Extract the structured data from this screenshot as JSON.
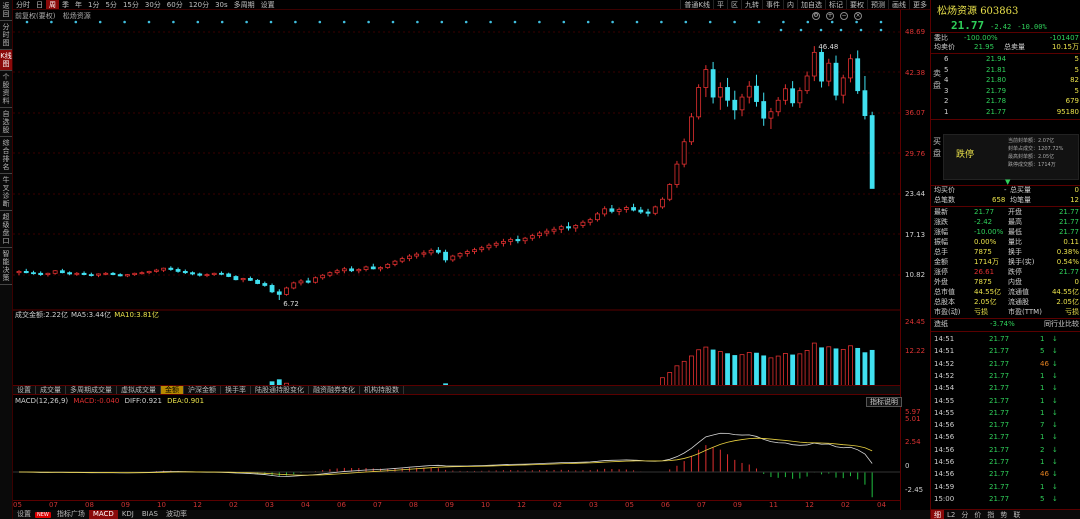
{
  "left_sidebar": [
    "返回",
    "分时图",
    "K线图",
    "个股资料",
    "自选股",
    "综合排名",
    "牛叉诊断",
    "超级盘口",
    "智能决策"
  ],
  "toolbar": {
    "left": [
      "分时",
      "日",
      "周",
      "季",
      "年",
      "1分",
      "5分",
      "15分",
      "30分",
      "60分",
      "120分",
      "30s",
      "多周期",
      "设置"
    ],
    "active_left": "周",
    "right": [
      "普通K线",
      "平",
      "区",
      "九转",
      "事件",
      "内",
      "加自选",
      "标记",
      "要权",
      "预测",
      "画线",
      "更多"
    ]
  },
  "stock_line": {
    "label": "前复权(要权)",
    "name": "松炀资源"
  },
  "price_axis": [
    "48.69",
    "42.38",
    "36.07",
    "29.76",
    "23.44",
    "17.13",
    "10.82"
  ],
  "price_marks": {
    "high": "46.48",
    "low": "6.72"
  },
  "volume": {
    "title": "成交金额:",
    "value": "2.22亿",
    "ma5_label": "MA5:",
    "ma5": "3.44亿",
    "ma10_label": "MA10:",
    "ma10": "3.81亿",
    "axis_top": "24.45",
    "axis_mid": "12.22"
  },
  "mid_tabs": [
    "设置",
    "成交量",
    "多周期成交量",
    "虚拟成交量",
    "金额",
    "沪深金额",
    "换手率",
    "陆股通持股变化",
    "融资融券变化",
    "机构持股数"
  ],
  "active_mid_tab": "金额",
  "macd": {
    "title": "MACD(12,26,9)",
    "macd_label": "MACD:",
    "macd": "-0.040",
    "diff_label": "DIFF:",
    "diff": "0.921",
    "dea_label": "DEA:",
    "dea": "0.901",
    "axis": [
      "5.97",
      "5.01",
      "2.54",
      "0",
      "-2.45"
    ],
    "indicator_button": "指标说明"
  },
  "dates": [
    "05",
    "07",
    "08",
    "09",
    "10",
    "12",
    "02",
    "03",
    "04",
    "06",
    "07",
    "08",
    "09",
    "10",
    "12",
    "02",
    "03",
    "05",
    "06",
    "07",
    "09",
    "11",
    "12",
    "02",
    "04"
  ],
  "bottom_tabs": [
    "设置",
    "指标广场",
    "MACD",
    "KDJ",
    "BIAS",
    "波动率"
  ],
  "new_badge": "NEW",
  "active_bottom_tab": "MACD",
  "right_panel": {
    "name": "松炀资源",
    "code": "603863",
    "price": "21.77",
    "change": "-2.42",
    "change_pct": "-10.00%",
    "weibi_label": "委比",
    "weibi": "-100.00%",
    "weicha": "-101407",
    "avg_sell_label": "均卖价",
    "avg_sell": "21.95",
    "total_sell_label": "总卖量",
    "total_sell": "10.15万",
    "sell_side_label": "卖盘",
    "asks": [
      [
        "6",
        "21.94",
        "5"
      ],
      [
        "5",
        "21.81",
        "5"
      ],
      [
        "4",
        "21.80",
        "82"
      ],
      [
        "3",
        "21.79",
        "5"
      ],
      [
        "2",
        "21.78",
        "679"
      ],
      [
        "1",
        "21.77",
        "95180"
      ]
    ],
    "buy_side_label": "买盘",
    "limit": {
      "text": "跌停",
      "lines": [
        "当前封单额：2.07亿",
        "封单占成交：1207.72%",
        "最高封单额：2.05亿",
        "跌停成交额：1714万"
      ]
    },
    "avg_buy_label": "均买价",
    "avg_buy": "-",
    "total_buy_label": "总买量",
    "total_buy": "0",
    "total_trades_label": "总笔数",
    "total_trades": "658",
    "avg_trade_label": "均笔量",
    "avg_trade": "12",
    "stats": [
      [
        "最新",
        "21.77",
        "开盘",
        "21.77"
      ],
      [
        "涨跌",
        "-2.42",
        "最高",
        "21.77"
      ],
      [
        "涨幅",
        "-10.00%",
        "最低",
        "21.77"
      ],
      [
        "振幅",
        "0.00%",
        "量比",
        "0.11"
      ],
      [
        "总手",
        "7875",
        "换手",
        "0.38%"
      ],
      [
        "金额",
        "1714万",
        "换手(实)",
        "0.54%"
      ],
      [
        "涨停",
        "26.61",
        "跌停",
        "21.77"
      ],
      [
        "外盘",
        "7875",
        "内盘",
        "0"
      ],
      [
        "总市值",
        "44.55亿",
        "流通值",
        "44.55亿"
      ],
      [
        "总股本",
        "2.05亿",
        "流通股",
        "2.05亿"
      ],
      [
        "市盈(动)",
        "亏损",
        "市盈(TTM)",
        "亏损"
      ]
    ],
    "industry": {
      "label": "造纸",
      "value": "-3.74%",
      "link": "同行业比较"
    },
    "trades": [
      [
        "14:51",
        "21.77",
        "1"
      ],
      [
        "14:51",
        "21.77",
        "5"
      ],
      [
        "14:52",
        "21.77",
        "46"
      ],
      [
        "14:52",
        "21.77",
        "1"
      ],
      [
        "14:54",
        "21.77",
        "1"
      ],
      [
        "14:55",
        "21.77",
        "1"
      ],
      [
        "14:55",
        "21.77",
        "1"
      ],
      [
        "14:56",
        "21.77",
        "7"
      ],
      [
        "14:56",
        "21.77",
        "1"
      ],
      [
        "14:56",
        "21.77",
        "2"
      ],
      [
        "14:56",
        "21.77",
        "1"
      ],
      [
        "14:56",
        "21.77",
        "46"
      ],
      [
        "14:59",
        "21.77",
        "1"
      ],
      [
        "15:00",
        "21.77",
        "5"
      ]
    ],
    "bottom_tabs": [
      "细",
      "L2",
      "分",
      "价",
      "指",
      "势",
      "联"
    ],
    "active_bottom_tab": "细"
  },
  "colors": {
    "up": "#e03030",
    "down": "#40e0f0",
    "ma1": "#e0e0e0",
    "ma2": "#e8d040",
    "grid": "#3a0000"
  },
  "chart_data": {
    "type": "candlestick",
    "ylim": [
      6.72,
      48.69
    ],
    "candles": [
      [
        11.0,
        11.4,
        10.6,
        11.2
      ],
      [
        11.2,
        11.6,
        10.9,
        11.0
      ],
      [
        11.0,
        11.3,
        10.7,
        10.9
      ],
      [
        10.9,
        11.2,
        10.5,
        10.7
      ],
      [
        10.7,
        11.0,
        10.4,
        10.9
      ],
      [
        10.9,
        11.4,
        10.7,
        11.3
      ],
      [
        11.3,
        11.6,
        10.9,
        11.0
      ],
      [
        11.0,
        11.2,
        10.6,
        10.8
      ],
      [
        10.8,
        11.1,
        10.5,
        10.9
      ],
      [
        10.9,
        11.2,
        10.6,
        10.7
      ],
      [
        10.7,
        11.0,
        10.4,
        10.6
      ],
      [
        10.6,
        10.9,
        10.3,
        10.8
      ],
      [
        10.8,
        11.1,
        10.6,
        10.9
      ],
      [
        10.9,
        11.1,
        10.6,
        10.7
      ],
      [
        10.7,
        10.9,
        10.4,
        10.5
      ],
      [
        10.5,
        10.8,
        10.3,
        10.7
      ],
      [
        10.7,
        11.0,
        10.5,
        10.9
      ],
      [
        10.9,
        11.2,
        10.7,
        11.0
      ],
      [
        11.0,
        11.3,
        10.8,
        11.2
      ],
      [
        11.2,
        11.6,
        11.0,
        11.4
      ],
      [
        11.4,
        11.8,
        11.1,
        11.7
      ],
      [
        11.7,
        12.0,
        11.3,
        11.5
      ],
      [
        11.5,
        11.8,
        11.0,
        11.2
      ],
      [
        11.2,
        11.5,
        10.8,
        11.0
      ],
      [
        11.0,
        11.2,
        10.6,
        10.8
      ],
      [
        10.8,
        11.0,
        10.4,
        10.6
      ],
      [
        10.6,
        10.9,
        10.3,
        10.7
      ],
      [
        10.7,
        11.0,
        10.5,
        10.9
      ],
      [
        10.9,
        11.2,
        10.6,
        10.8
      ],
      [
        10.8,
        11.0,
        10.3,
        10.4
      ],
      [
        10.4,
        10.6,
        9.8,
        9.9
      ],
      [
        9.9,
        10.2,
        9.5,
        10.1
      ],
      [
        10.1,
        10.4,
        9.7,
        9.8
      ],
      [
        9.8,
        10.0,
        9.2,
        9.3
      ],
      [
        9.3,
        9.6,
        8.8,
        9.0
      ],
      [
        9.0,
        9.3,
        7.8,
        8.0
      ],
      [
        8.0,
        8.4,
        6.72,
        7.6
      ],
      [
        7.6,
        8.8,
        7.4,
        8.6
      ],
      [
        8.6,
        9.6,
        8.4,
        9.4
      ],
      [
        9.4,
        10.0,
        9.0,
        9.7
      ],
      [
        9.7,
        10.2,
        9.3,
        9.5
      ],
      [
        9.5,
        10.4,
        9.3,
        10.2
      ],
      [
        10.2,
        10.8,
        9.9,
        10.6
      ],
      [
        10.6,
        11.2,
        10.3,
        11.0
      ],
      [
        11.0,
        11.6,
        10.7,
        11.3
      ],
      [
        11.3,
        11.9,
        10.9,
        11.6
      ],
      [
        11.6,
        12.0,
        11.1,
        11.3
      ],
      [
        11.3,
        11.7,
        10.9,
        11.5
      ],
      [
        11.5,
        12.1,
        11.2,
        11.9
      ],
      [
        11.9,
        12.4,
        11.5,
        11.6
      ],
      [
        11.6,
        12.0,
        11.2,
        11.8
      ],
      [
        11.8,
        12.5,
        11.6,
        12.3
      ],
      [
        12.3,
        13.0,
        12.0,
        12.8
      ],
      [
        12.8,
        13.5,
        12.5,
        13.2
      ],
      [
        13.2,
        13.9,
        12.8,
        13.6
      ],
      [
        13.6,
        14.2,
        13.2,
        13.9
      ],
      [
        13.9,
        14.5,
        13.4,
        14.1
      ],
      [
        14.1,
        14.8,
        13.7,
        14.5
      ],
      [
        14.5,
        15.0,
        13.9,
        14.2
      ],
      [
        14.2,
        14.6,
        12.6,
        13.0
      ],
      [
        13.0,
        13.8,
        12.7,
        13.6
      ],
      [
        13.6,
        14.2,
        13.2,
        14.0
      ],
      [
        14.0,
        14.6,
        13.5,
        14.3
      ],
      [
        14.3,
        14.9,
        13.9,
        14.6
      ],
      [
        14.6,
        15.2,
        14.2,
        14.9
      ],
      [
        14.9,
        15.6,
        14.5,
        15.3
      ],
      [
        15.3,
        15.9,
        14.9,
        15.6
      ],
      [
        15.6,
        16.3,
        15.1,
        15.9
      ],
      [
        15.9,
        16.5,
        15.3,
        16.2
      ],
      [
        16.2,
        16.8,
        15.6,
        16.0
      ],
      [
        16.0,
        16.6,
        15.5,
        16.4
      ],
      [
        16.4,
        17.1,
        16.0,
        16.8
      ],
      [
        16.8,
        17.5,
        16.4,
        17.2
      ],
      [
        17.2,
        17.9,
        16.7,
        17.5
      ],
      [
        17.5,
        18.2,
        17.0,
        17.8
      ],
      [
        17.8,
        18.5,
        17.2,
        18.2
      ],
      [
        18.2,
        18.9,
        17.6,
        18.0
      ],
      [
        18.0,
        18.6,
        17.4,
        18.4
      ],
      [
        18.4,
        19.2,
        18.0,
        18.9
      ],
      [
        18.9,
        19.6,
        18.4,
        19.3
      ],
      [
        19.3,
        20.5,
        19.0,
        20.2
      ],
      [
        20.2,
        21.4,
        19.8,
        21.0
      ],
      [
        21.0,
        21.6,
        20.3,
        20.6
      ],
      [
        20.6,
        21.2,
        20.0,
        20.9
      ],
      [
        20.9,
        21.5,
        20.4,
        21.2
      ],
      [
        21.2,
        21.8,
        20.6,
        20.8
      ],
      [
        20.8,
        21.3,
        20.2,
        20.5
      ],
      [
        20.5,
        21.0,
        19.8,
        20.3
      ],
      [
        20.3,
        21.5,
        20.0,
        21.3
      ],
      [
        21.3,
        22.8,
        21.0,
        22.5
      ],
      [
        22.5,
        25.0,
        22.2,
        24.8
      ],
      [
        24.8,
        28.5,
        24.3,
        28.0
      ],
      [
        28.0,
        32.0,
        27.5,
        31.5
      ],
      [
        31.5,
        36.0,
        31.0,
        35.4
      ],
      [
        35.4,
        40.5,
        35.0,
        40.0
      ],
      [
        40.0,
        43.5,
        38.5,
        42.8
      ],
      [
        42.8,
        44.0,
        37.5,
        38.5
      ],
      [
        38.5,
        40.8,
        36.5,
        40.0
      ],
      [
        40.0,
        41.5,
        37.0,
        38.0
      ],
      [
        38.0,
        39.5,
        35.0,
        36.5
      ],
      [
        36.5,
        39.0,
        35.5,
        38.5
      ],
      [
        38.5,
        41.0,
        37.5,
        40.2
      ],
      [
        40.2,
        42.0,
        37.0,
        37.8
      ],
      [
        37.8,
        39.2,
        34.0,
        35.2
      ],
      [
        35.2,
        36.8,
        33.5,
        36.2
      ],
      [
        36.2,
        38.5,
        35.5,
        38.0
      ],
      [
        38.0,
        40.5,
        37.3,
        39.8
      ],
      [
        39.8,
        41.0,
        37.0,
        37.6
      ],
      [
        37.6,
        40.0,
        36.8,
        39.5
      ],
      [
        39.5,
        42.5,
        39.0,
        41.8
      ],
      [
        41.8,
        46.48,
        41.0,
        45.5
      ],
      [
        45.5,
        46.0,
        40.0,
        41.0
      ],
      [
        41.0,
        44.5,
        40.2,
        43.8
      ],
      [
        43.8,
        45.0,
        38.0,
        38.8
      ],
      [
        38.8,
        42.0,
        37.5,
        41.5
      ],
      [
        41.5,
        45.2,
        40.8,
        44.5
      ],
      [
        44.5,
        45.8,
        39.0,
        39.5
      ],
      [
        39.5,
        41.8,
        35.0,
        35.6
      ],
      [
        35.6,
        36.2,
        24.19,
        24.19
      ]
    ]
  }
}
